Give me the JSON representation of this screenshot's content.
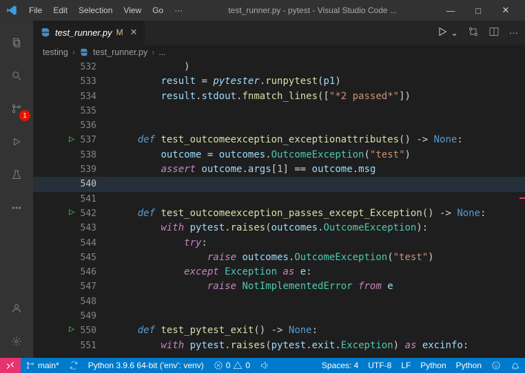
{
  "titlebar": {
    "menu": [
      "File",
      "Edit",
      "Selection",
      "View",
      "Go",
      "···"
    ],
    "title": "test_runner.py - pytest - Visual Studio Code ...",
    "winMin": "—",
    "winMax": "□",
    "winClose": "✕"
  },
  "activity": {
    "scm_badge": "1"
  },
  "tab": {
    "filename": "test_runner.py",
    "mod": "M",
    "close": "✕"
  },
  "tabActions": {
    "run": "▷",
    "chev": "⌄",
    "diff": "",
    "split": "",
    "more": "···"
  },
  "breadcrumb": {
    "seg1": "testing",
    "seg2": "test_runner.py",
    "seg3": "..."
  },
  "lines": [
    {
      "n": "532",
      "ind": 3,
      "tokens": [
        {
          "t": ")",
          "c": "tok-op"
        }
      ]
    },
    {
      "n": "533",
      "ind": 2,
      "tokens": [
        {
          "t": "result",
          "c": "tok-var"
        },
        {
          "t": " = ",
          "c": "tok-op"
        },
        {
          "t": "pytester",
          "c": "tok-var",
          "i": true
        },
        {
          "t": ".",
          "c": "tok-op"
        },
        {
          "t": "runpytest",
          "c": "tok-fn"
        },
        {
          "t": "(",
          "c": "tok-op"
        },
        {
          "t": "p1",
          "c": "tok-var"
        },
        {
          "t": ")",
          "c": "tok-op"
        }
      ]
    },
    {
      "n": "534",
      "ind": 2,
      "tokens": [
        {
          "t": "result",
          "c": "tok-var"
        },
        {
          "t": ".",
          "c": "tok-op"
        },
        {
          "t": "stdout",
          "c": "tok-var"
        },
        {
          "t": ".",
          "c": "tok-op"
        },
        {
          "t": "fnmatch_lines",
          "c": "tok-fn"
        },
        {
          "t": "([",
          "c": "tok-op"
        },
        {
          "t": "\"*2 passed*\"",
          "c": "tok-str"
        },
        {
          "t": "])",
          "c": "tok-op"
        }
      ]
    },
    {
      "n": "535",
      "ind": 0,
      "tokens": []
    },
    {
      "n": "536",
      "ind": 0,
      "tokens": []
    },
    {
      "n": "537",
      "ind": 1,
      "run": true,
      "tokens": [
        {
          "t": "def",
          "c": "tok-kw"
        },
        {
          "t": " ",
          "c": "tok-op"
        },
        {
          "t": "test_outcomeexception_exceptionattributes",
          "c": "tok-fn"
        },
        {
          "t": "() -> ",
          "c": "tok-op"
        },
        {
          "t": "None",
          "c": "tok-const"
        },
        {
          "t": ":",
          "c": "tok-op"
        }
      ]
    },
    {
      "n": "538",
      "ind": 2,
      "tokens": [
        {
          "t": "outcome",
          "c": "tok-var"
        },
        {
          "t": " = ",
          "c": "tok-op"
        },
        {
          "t": "outcomes",
          "c": "tok-var"
        },
        {
          "t": ".",
          "c": "tok-op"
        },
        {
          "t": "OutcomeException",
          "c": "tok-cls"
        },
        {
          "t": "(",
          "c": "tok-op"
        },
        {
          "t": "\"test\"",
          "c": "tok-str"
        },
        {
          "t": ")",
          "c": "tok-op"
        }
      ]
    },
    {
      "n": "539",
      "ind": 2,
      "tokens": [
        {
          "t": "assert",
          "c": "tok-kw2"
        },
        {
          "t": " ",
          "c": "tok-op"
        },
        {
          "t": "outcome",
          "c": "tok-var"
        },
        {
          "t": ".",
          "c": "tok-op"
        },
        {
          "t": "args",
          "c": "tok-var"
        },
        {
          "t": "[",
          "c": "tok-op"
        },
        {
          "t": "1",
          "c": "tok-num"
        },
        {
          "t": "] == ",
          "c": "tok-op"
        },
        {
          "t": "outcome",
          "c": "tok-var"
        },
        {
          "t": ".",
          "c": "tok-op"
        },
        {
          "t": "msg",
          "c": "tok-var"
        }
      ]
    },
    {
      "n": "540",
      "ind": 0,
      "active": true,
      "tokens": []
    },
    {
      "n": "541",
      "ind": 0,
      "tokens": []
    },
    {
      "n": "542",
      "ind": 1,
      "run": true,
      "tokens": [
        {
          "t": "def",
          "c": "tok-kw"
        },
        {
          "t": " ",
          "c": "tok-op"
        },
        {
          "t": "test_outcomeexception_passes_except_Exception",
          "c": "tok-fn"
        },
        {
          "t": "() -> ",
          "c": "tok-op"
        },
        {
          "t": "None",
          "c": "tok-const"
        },
        {
          "t": ":",
          "c": "tok-op"
        }
      ]
    },
    {
      "n": "543",
      "ind": 2,
      "tokens": [
        {
          "t": "with",
          "c": "tok-kw2"
        },
        {
          "t": " ",
          "c": "tok-op"
        },
        {
          "t": "pytest",
          "c": "tok-var"
        },
        {
          "t": ".",
          "c": "tok-op"
        },
        {
          "t": "raises",
          "c": "tok-fn"
        },
        {
          "t": "(",
          "c": "tok-op"
        },
        {
          "t": "outcomes",
          "c": "tok-var"
        },
        {
          "t": ".",
          "c": "tok-op"
        },
        {
          "t": "OutcomeException",
          "c": "tok-cls"
        },
        {
          "t": "):",
          "c": "tok-op"
        }
      ]
    },
    {
      "n": "544",
      "ind": 3,
      "tokens": [
        {
          "t": "try",
          "c": "tok-kw2"
        },
        {
          "t": ":",
          "c": "tok-op"
        }
      ]
    },
    {
      "n": "545",
      "ind": 4,
      "tokens": [
        {
          "t": "raise",
          "c": "tok-kw2"
        },
        {
          "t": " ",
          "c": "tok-op"
        },
        {
          "t": "outcomes",
          "c": "tok-var"
        },
        {
          "t": ".",
          "c": "tok-op"
        },
        {
          "t": "OutcomeException",
          "c": "tok-cls"
        },
        {
          "t": "(",
          "c": "tok-op"
        },
        {
          "t": "\"test\"",
          "c": "tok-str"
        },
        {
          "t": ")",
          "c": "tok-op"
        }
      ]
    },
    {
      "n": "546",
      "ind": 3,
      "tokens": [
        {
          "t": "except",
          "c": "tok-kw2"
        },
        {
          "t": " ",
          "c": "tok-op"
        },
        {
          "t": "Exception",
          "c": "tok-cls"
        },
        {
          "t": " ",
          "c": "tok-op"
        },
        {
          "t": "as",
          "c": "tok-kw2"
        },
        {
          "t": " ",
          "c": "tok-op"
        },
        {
          "t": "e",
          "c": "tok-var"
        },
        {
          "t": ":",
          "c": "tok-op"
        }
      ]
    },
    {
      "n": "547",
      "ind": 4,
      "tokens": [
        {
          "t": "raise",
          "c": "tok-kw2"
        },
        {
          "t": " ",
          "c": "tok-op"
        },
        {
          "t": "NotImplementedError",
          "c": "tok-cls"
        },
        {
          "t": " ",
          "c": "tok-op"
        },
        {
          "t": "from",
          "c": "tok-kw2"
        },
        {
          "t": " ",
          "c": "tok-op"
        },
        {
          "t": "e",
          "c": "tok-var"
        }
      ]
    },
    {
      "n": "548",
      "ind": 0,
      "tokens": []
    },
    {
      "n": "549",
      "ind": 0,
      "tokens": []
    },
    {
      "n": "550",
      "ind": 1,
      "run": true,
      "tokens": [
        {
          "t": "def",
          "c": "tok-kw"
        },
        {
          "t": " ",
          "c": "tok-op"
        },
        {
          "t": "test_pytest_exit",
          "c": "tok-fn"
        },
        {
          "t": "() -> ",
          "c": "tok-op"
        },
        {
          "t": "None",
          "c": "tok-const"
        },
        {
          "t": ":",
          "c": "tok-op"
        }
      ]
    },
    {
      "n": "551",
      "ind": 2,
      "tokens": [
        {
          "t": "with",
          "c": "tok-kw2"
        },
        {
          "t": " ",
          "c": "tok-op"
        },
        {
          "t": "pytest",
          "c": "tok-var"
        },
        {
          "t": ".",
          "c": "tok-op"
        },
        {
          "t": "raises",
          "c": "tok-fn"
        },
        {
          "t": "(",
          "c": "tok-op"
        },
        {
          "t": "pytest",
          "c": "tok-var"
        },
        {
          "t": ".",
          "c": "tok-op"
        },
        {
          "t": "exit",
          "c": "tok-var"
        },
        {
          "t": ".",
          "c": "tok-op"
        },
        {
          "t": "Exception",
          "c": "tok-cls"
        },
        {
          "t": ") ",
          "c": "tok-op"
        },
        {
          "t": "as",
          "c": "tok-kw2"
        },
        {
          "t": " ",
          "c": "tok-op"
        },
        {
          "t": "excinfo",
          "c": "tok-var"
        },
        {
          "t": ":",
          "c": "tok-op"
        }
      ]
    }
  ],
  "statusbar": {
    "branch": "main*",
    "interpreter": "Python 3.9.6 64-bit ('env': venv)",
    "errors": "0",
    "warnings": "0",
    "spaces": "Spaces: 4",
    "encoding": "UTF-8",
    "eol": "LF",
    "lang": "Python",
    "formatter": "Python"
  }
}
